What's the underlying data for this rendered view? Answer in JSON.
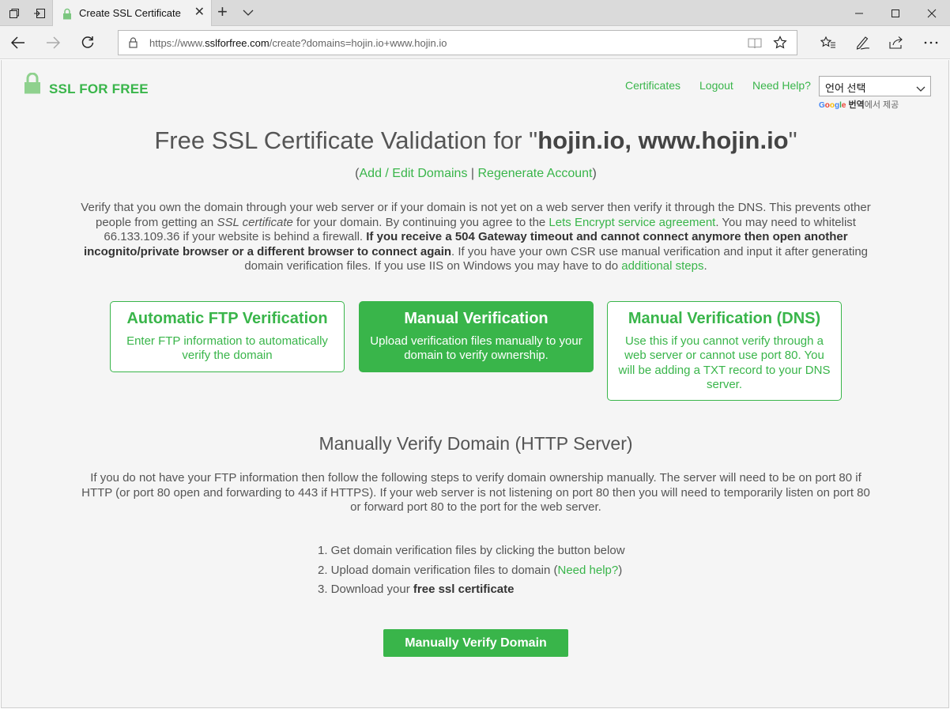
{
  "browser": {
    "tab_title": "Create SSL Certificate",
    "url_prefix": "https://www.",
    "url_host": "sslforfree.com",
    "url_path": "/create?domains=hojin.io+www.hojin.io"
  },
  "header": {
    "logo_text": "SSL FOR FREE",
    "links": [
      "Certificates",
      "Logout",
      "Need Help?"
    ],
    "lang_select": "언어 선택",
    "powered_by_brand": "Google",
    "powered_by_bold": "번역",
    "powered_by_suffix": "에서 제공"
  },
  "page": {
    "title_prefix": "Free SSL Certificate Validation for \"",
    "title_domains": "hojin.io, www.hojin.io",
    "title_suffix": "\"",
    "sub_open": "(",
    "sub_link1": "Add / Edit Domains",
    "sub_sep": " | ",
    "sub_link2": "Regenerate Account",
    "sub_close": ")",
    "intro_1": "Verify that you own the domain through your web server or if your domain is not yet on a web server then verify it through the DNS. This prevents other people from getting an ",
    "intro_italic": "SSL certificate",
    "intro_2": " for your domain. By continuing you agree to the ",
    "intro_link1": "Lets Encrypt service agreement",
    "intro_3": ". You may need to whitelist 66.133.109.36 if your website is behind a firewall. ",
    "intro_bold": "If you receive a 504 Gateway timeout and cannot connect anymore then open another incognito/private browser or a different browser to connect again",
    "intro_4": ". If you have your own CSR use manual verification and input it after generating domain verification files. If you use IIS on Windows you may have to do ",
    "intro_link2": "additional steps",
    "intro_5": "."
  },
  "cards": [
    {
      "title": "Automatic FTP Verification",
      "desc": "Enter FTP information to automatically verify the domain"
    },
    {
      "title": "Manual Verification",
      "desc": "Upload verification files manually to your domain to verify ownership."
    },
    {
      "title": "Manual Verification (DNS)",
      "desc": "Use this if you cannot verify through a web server or cannot use port 80. You will be adding a TXT record to your DNS server."
    }
  ],
  "manual": {
    "section_title": "Manually Verify Domain (HTTP Server)",
    "description": "If you do not have your FTP information then follow the following steps to verify domain ownership manually. The server will need to be on port 80 if HTTP (or port 80 open and forwarding to 443 if HTTPS). If your web server is not listening on port 80 then you will need to temporarily listen on port 80 or forward port 80 to the port for the web server.",
    "step1": "1.  Get domain verification files by clicking the button below",
    "step2_pre": "2.  Upload domain verification files to domain (",
    "step2_link": "Need help?",
    "step2_post": ")",
    "step3_pre": "3.  Download your ",
    "step3_bold": "free ssl certificate",
    "button": "Manually Verify Domain"
  }
}
